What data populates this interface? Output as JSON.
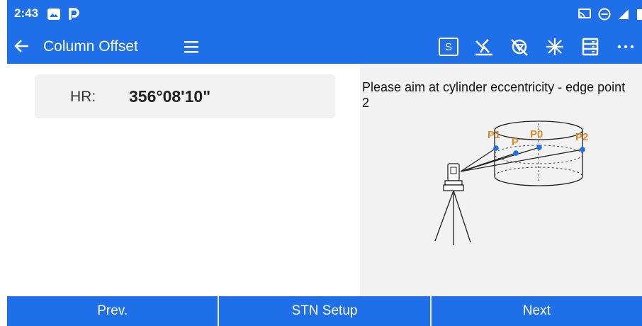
{
  "status_bar": {
    "time": "2:43",
    "left_icons": [
      "gallery-icon",
      "parking-p-icon"
    ],
    "right_icons": [
      "cast-icon",
      "do-not-disturb-icon",
      "signal-icon",
      "battery-icon"
    ]
  },
  "app_bar": {
    "title": "Column Offset",
    "s_label": "S",
    "icons": [
      "back-arrow-icon",
      "hamburger-menu-icon",
      "s-mode-icon",
      "laser-off-icon",
      "prism-off-icon",
      "laser-pointer-icon",
      "storage-list-icon",
      "more-icon"
    ]
  },
  "measurement": {
    "hr_label": "HR:",
    "hr_value": "356°08'10\""
  },
  "instruction": {
    "text": "Please aim at cylinder eccentricity - edge point 2"
  },
  "diagram": {
    "labels": [
      "P1",
      "P",
      "P0",
      "P2"
    ],
    "label_color": "#e08a2e",
    "point_color": "#1f6fe8"
  },
  "bottom_bar": {
    "prev_label": "Prev.",
    "stn_setup_label": "STN Setup",
    "next_label": "Next"
  },
  "colors": {
    "accent": "#1f6fe8",
    "panel_gray": "#f2f2f2"
  }
}
